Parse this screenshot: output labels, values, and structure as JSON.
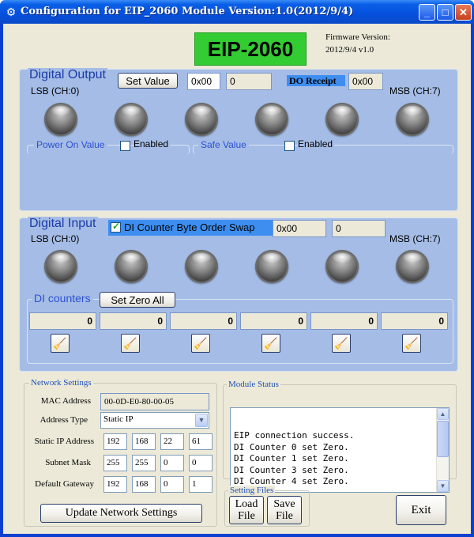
{
  "window": {
    "title": "Configuration for EIP_2060 Module Version:1.0(2012/9/4)",
    "controls": {
      "minimize": "_",
      "maximize": "□",
      "close": "✕"
    }
  },
  "header": {
    "logo": "EIP-2060",
    "firmware_label": "Firmware Version:",
    "firmware_value": "2012/9/4 v1.0"
  },
  "digital_output": {
    "title": "Digital Output",
    "set_value_button": "Set Value",
    "hex_value": "0x00",
    "dec_value": "0",
    "do_receipt_label": "DO Receipt",
    "do_receipt_value": "0x00",
    "lsb_label": "LSB (CH:0)",
    "msb_label": "MSB (CH:7)",
    "power_on_label": "Power On Value",
    "power_on_enabled_label": "Enabled",
    "power_on_enabled": false,
    "safe_value_label": "Safe Value",
    "safe_enabled_label": "Enabled",
    "safe_enabled": false,
    "led_count": 6
  },
  "digital_input": {
    "title": "Digital Input",
    "swap_label": "DI Counter Byte Order Swap",
    "swap_checked": true,
    "hex_value": "0x00",
    "dec_value": "0",
    "lsb_label": "LSB (CH:0)",
    "msb_label": "MSB (CH:7)",
    "counters_label": "DI counters",
    "set_zero_all_button": "Set Zero All",
    "counters": [
      "0",
      "0",
      "0",
      "0",
      "0",
      "0"
    ]
  },
  "network": {
    "title": "Network Settings",
    "mac_label": "MAC Address",
    "mac_value": "00-0D-E0-80-00-05",
    "address_type_label": "Address Type",
    "address_type_value": "Static IP",
    "static_ip_label": "Static IP Address",
    "static_ip": [
      "192",
      "168",
      "22",
      "61"
    ],
    "subnet_label": "Subnet Mask",
    "subnet": [
      "255",
      "255",
      "0",
      "0"
    ],
    "gateway_label": "Default Gateway",
    "gateway": [
      "192",
      "168",
      "0",
      "1"
    ],
    "update_button": "Update Network Settings"
  },
  "module_status": {
    "title": "Module Status",
    "lines": [
      "EIP connection success.",
      "DI Counter 0 set Zero.",
      "DI Counter 1 set Zero.",
      "DI Counter 3 set Zero.",
      "DI Counter 4 set Zero."
    ]
  },
  "setting_files": {
    "title": "Setting Files",
    "load_button_line1": "Load",
    "load_button_line2": "File",
    "save_button_line1": "Save",
    "save_button_line2": "File"
  },
  "exit_button": "Exit",
  "colors": {
    "title_bar": "#0a5fe6",
    "panel_bg": "#a5bde6",
    "panel_title": "#1a3aa8",
    "logo_bg": "#33cc33",
    "do_receipt_bg": "#3d8ef0",
    "swap_bg": "#3d8ef0",
    "form_bg": "#ece9d8"
  }
}
